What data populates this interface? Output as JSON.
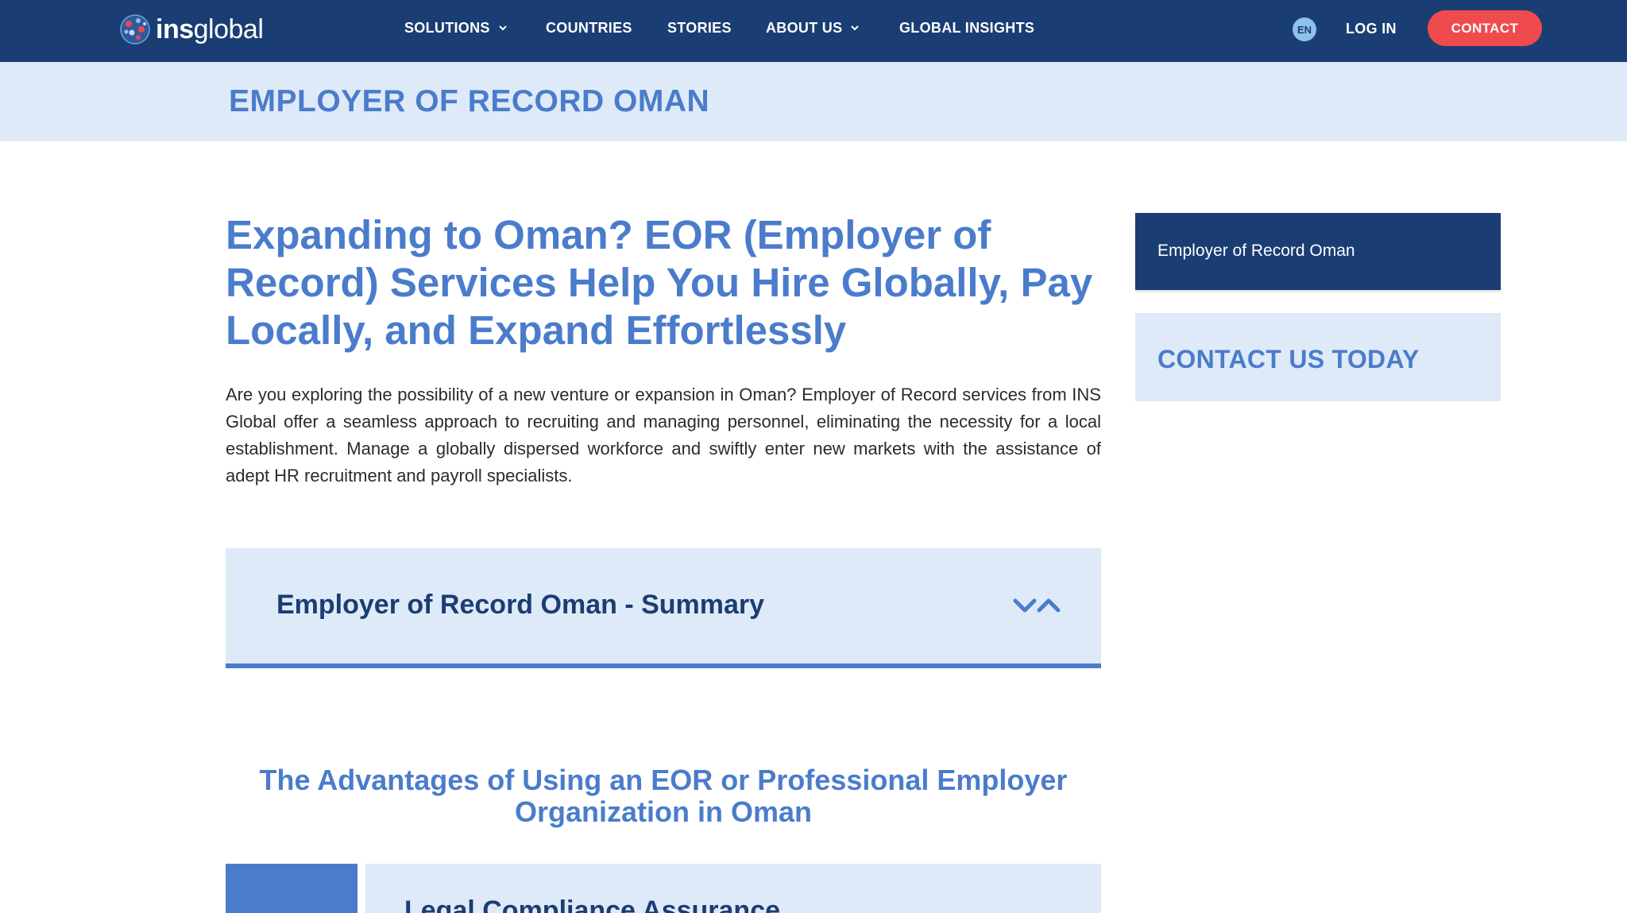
{
  "header": {
    "logo": {
      "bold": "ins",
      "light": "global"
    },
    "nav": [
      {
        "label": "SOLUTIONS",
        "has_dropdown": true
      },
      {
        "label": "COUNTRIES",
        "has_dropdown": false
      },
      {
        "label": "STORIES",
        "has_dropdown": false
      },
      {
        "label": "ABOUT US",
        "has_dropdown": true
      },
      {
        "label": "GLOBAL INSIGHTS",
        "has_dropdown": false
      }
    ],
    "language": "EN",
    "login_label": "LOG IN",
    "contact_label": "CONTACT"
  },
  "title_band": {
    "title": "EMPLOYER OF RECORD OMAN"
  },
  "main": {
    "heading": "Expanding to Oman? EOR (Employer of Record) Services Help You Hire Globally, Pay Locally, and Expand Effortlessly",
    "intro": "Are you exploring the possibility of a new venture or expansion in Oman? Employer of Record services from INS Global offer a seamless approach to recruiting and managing personnel, eliminating the necessity for a local establishment. Manage a globally dispersed workforce and swiftly enter new markets with the assistance of adept HR recruitment and payroll specialists.",
    "accordion": {
      "title": "Employer of Record Oman - Summary",
      "toggle_icon": "chevron-toggle-icon"
    },
    "section_heading": "The Advantages of Using an EOR or Professional Employer Organization in Oman",
    "card": {
      "title": "Legal Compliance Assurance"
    }
  },
  "sidebar": {
    "nav_item": "Employer of Record Oman",
    "cta": "CONTACT US TODAY"
  },
  "colors": {
    "navy": "#1a3d73",
    "accent_blue": "#4a7ccb",
    "light_blue": "#dfeaf8",
    "contact_red": "#ef4a4d"
  }
}
